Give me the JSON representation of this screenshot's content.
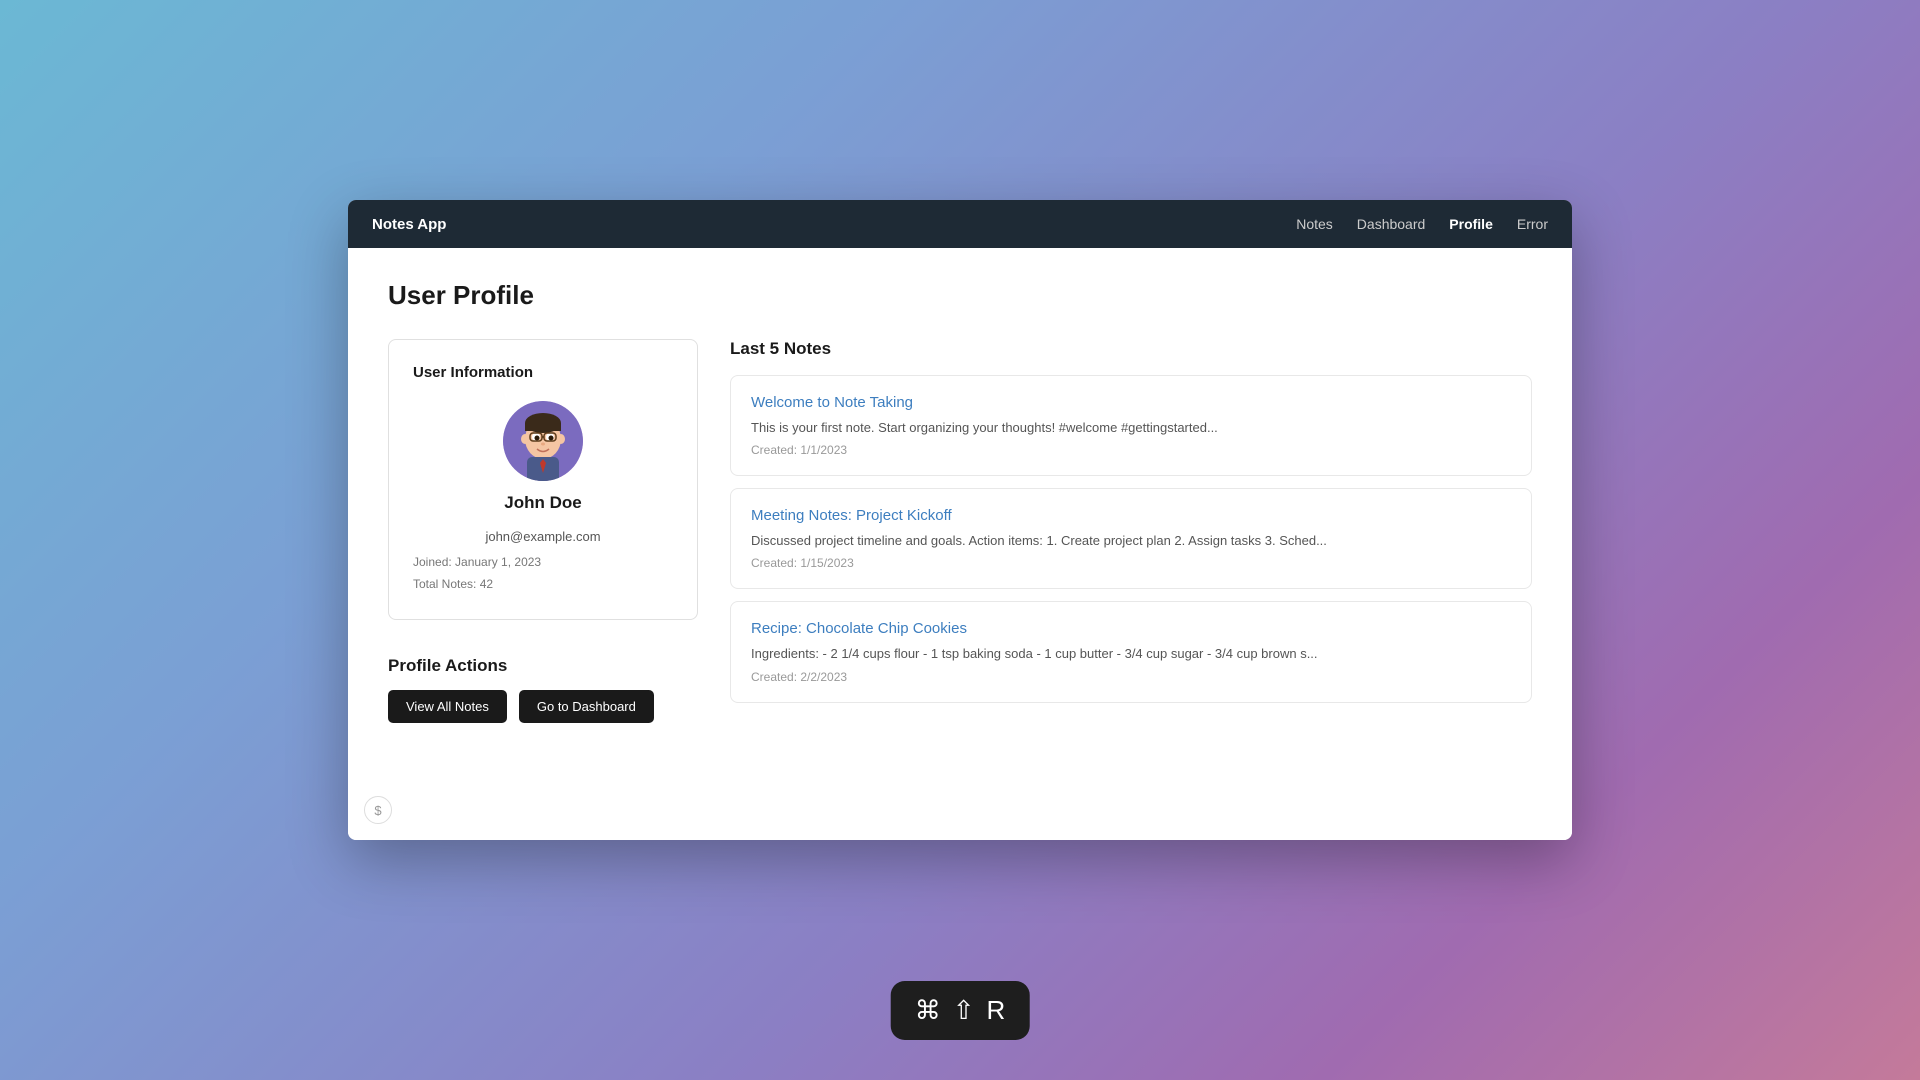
{
  "app": {
    "brand": "Notes App"
  },
  "navbar": {
    "links": [
      {
        "label": "Notes",
        "id": "notes"
      },
      {
        "label": "Dashboard",
        "id": "dashboard"
      },
      {
        "label": "Profile",
        "id": "profile"
      },
      {
        "label": "Error",
        "id": "error"
      }
    ]
  },
  "page": {
    "title": "User Profile"
  },
  "user_info": {
    "section_title": "User Information",
    "name": "John Doe",
    "email": "john@example.com",
    "joined": "Joined: January 1, 2023",
    "total_notes": "Total Notes: 42"
  },
  "last_notes": {
    "section_title": "Last 5 Notes",
    "notes": [
      {
        "title": "Welcome to Note Taking",
        "preview": "This is your first note. Start organizing your thoughts! #welcome #gettingstarted...",
        "date": "Created: 1/1/2023"
      },
      {
        "title": "Meeting Notes: Project Kickoff",
        "preview": "Discussed project timeline and goals. Action items: 1. Create project plan 2. Assign tasks 3. Sched...",
        "date": "Created: 1/15/2023"
      },
      {
        "title": "Recipe: Chocolate Chip Cookies",
        "preview": "Ingredients: - 2 1/4 cups flour - 1 tsp baking soda - 1 cup butter - 3/4 cup sugar - 3/4 cup brown s...",
        "date": "Created: 2/2/2023"
      }
    ]
  },
  "profile_actions": {
    "title": "Profile Actions",
    "view_all_notes": "View All Notes",
    "go_to_dashboard": "Go to Dashboard"
  },
  "keyboard_shortcut": {
    "symbols": [
      "⌘",
      "⇧",
      "R"
    ]
  }
}
